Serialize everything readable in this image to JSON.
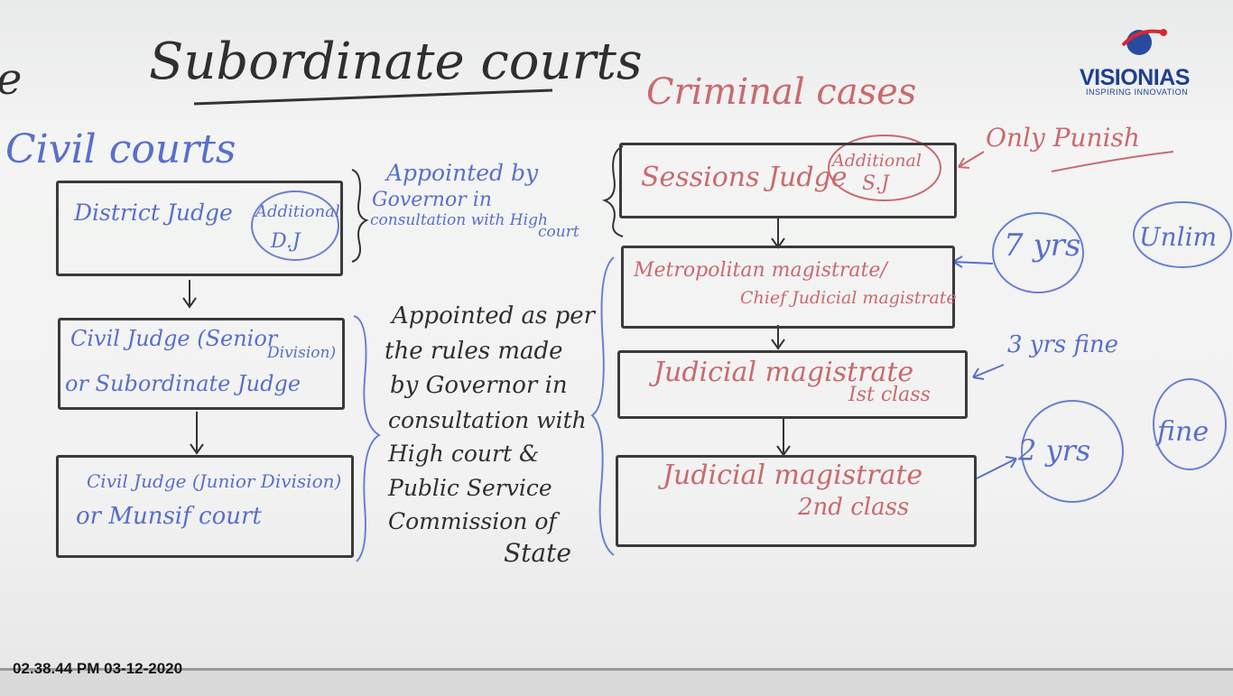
{
  "title": "Subordinate courts",
  "partial_left": "e",
  "civil": {
    "heading": "Civil courts",
    "box1": {
      "main": "District Judge",
      "circled_line1": "Additional",
      "circled_line2": "D.J"
    },
    "appointed_1_line1": "Appointed by",
    "appointed_1_line2": "Governor in",
    "appointed_1_line3": "consultation with High",
    "appointed_1_line4": "court",
    "box2": {
      "line1": "Civil Judge (Senior",
      "line1b": "Division)",
      "line2": "or Subordinate Judge"
    },
    "box3": {
      "line1": "Civil Judge (Junior Division)",
      "line2": "or Munsif court"
    },
    "appointed_2": [
      "Appointed as per",
      "the rules made",
      "by Governor in",
      "consultation with",
      "High court &",
      "Public Service",
      "Commission of",
      "State"
    ]
  },
  "criminal": {
    "heading": "Criminal cases",
    "box1": {
      "main": "Sessions Judge",
      "circled_line1": "Additional",
      "circled_line2": "S.J"
    },
    "box1_note": "Only Punish",
    "box2": {
      "line1": "Metropolitan magistrate/",
      "line2": "Chief Judicial magistrate"
    },
    "box2_note_a": "7 yrs",
    "box2_note_b": "Unlim",
    "box3": {
      "line1": "Judicial magistrate",
      "line2": "Ist class"
    },
    "box3_note": "3 yrs fine",
    "box4": {
      "line1": "Judicial magistrate",
      "line2": "2nd class"
    },
    "box4_note_a": "2 yrs",
    "box4_note_b": "fine"
  },
  "logo": {
    "name": "VISIONIAS",
    "tagline": "INSPIRING INNOVATION"
  },
  "timestamp": "02.38.44 PM 03-12-2020"
}
